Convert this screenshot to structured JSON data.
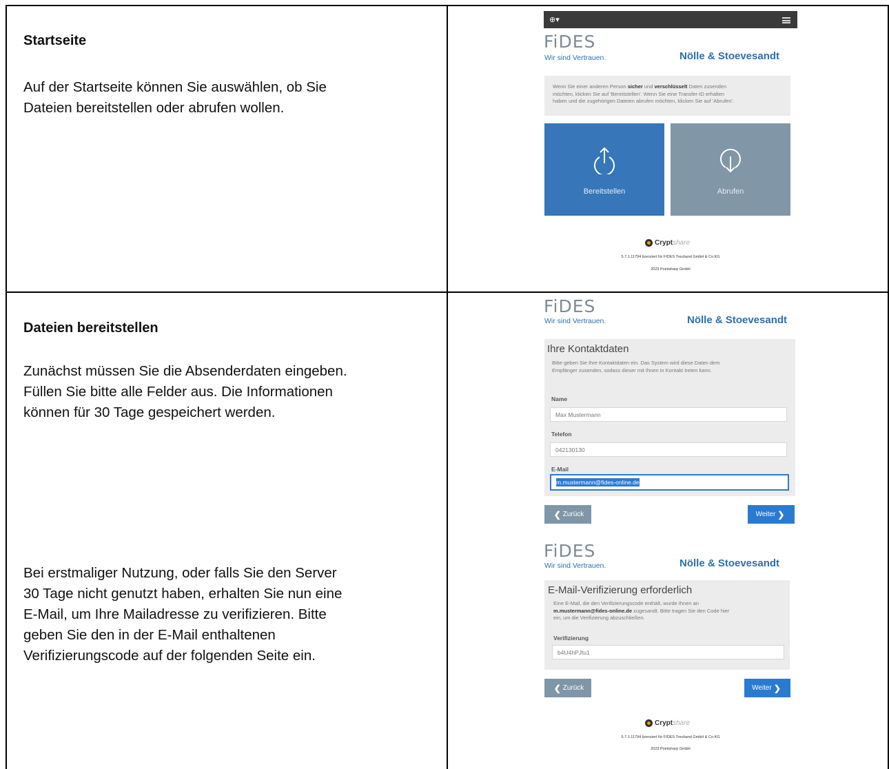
{
  "sections": [
    {
      "heading": "Startseite",
      "paragraphs": [
        "Auf der Startseite können Sie auswählen, ob Sie",
        "Dateien bereitstellen oder abrufen wollen."
      ]
    },
    {
      "heading": "Dateien bereitstellen",
      "paragraphs": [
        "Zunächst müssen Sie die Absenderdaten eingeben.",
        "Füllen Sie bitte alle Felder aus. Die Informationen",
        "können für 30 Tage gespeichert werden."
      ],
      "paragraphs2": [
        "Bei erstmaliger Nutzung, oder falls Sie den Server",
        "30 Tage nicht genutzt haben, erhalten Sie nun eine",
        "E-Mail, um Ihre Mailadresse zu verifizieren. Bitte",
        "geben Sie den in der E-Mail enthaltenen",
        "Verifizierungscode auf der folgenden Seite ein."
      ]
    }
  ],
  "brand": {
    "logo": "FiDES",
    "tagline": "Wir sind Vertrauen.",
    "partner": "Nölle & Stoevesandt",
    "colors": {
      "accent": "#2b7ad1",
      "tile_upload": "#3676b9",
      "tile_download": "#8196a6",
      "logo_gray": "#7e8b95"
    }
  },
  "screen_start": {
    "topbar": {
      "globe_icon": "globe-icon",
      "menu_icon": "hamburger-icon",
      "globe_glyph": "⊕▾"
    },
    "intro": {
      "line1_a": "Wenn Sie einer anderen Person ",
      "line1_b": "sicher",
      "line1_c": " und ",
      "line1_d": "verschlüsselt",
      "line1_e": " Daten zusenden",
      "line2": "möchten, klicken Sie auf 'Bereitstellen'. Wenn Sie eine Transfer-ID erhalten",
      "line3": "haben und die zugehörigen Dateien abrufen möchten, klicken Sie auf 'Abrufen'."
    },
    "tiles": {
      "upload": "Bereitstellen",
      "download": "Abrufen"
    }
  },
  "screen_contact": {
    "title": "Ihre Kontaktdaten",
    "desc1": "Bitte geben Sie Ihre Kontaktdaten ein. Das System wird diese Daten dem",
    "desc2": "Empfänger zusenden, sodass dieser mit Ihnen in Kontakt treten kann.",
    "name_label": "Name",
    "name_value": "Max Mustermann",
    "phone_label": "Telefon",
    "phone_value": "042130130",
    "email_label": "E-Mail",
    "email_value": "m.mustermann@fides-online.de",
    "back": "Zurück",
    "next": "Weiter"
  },
  "screen_verify": {
    "title": "E-Mail-Verifizierung erforderlich",
    "desc1": "Eine E-Mail, die den Verifizierungscode enthält, wurde Ihnen an",
    "desc2_bold": "m.mustermann@fides-online.de",
    "desc2_rest": " zugesandt. Bitte tragen Sie den Code hier",
    "desc3": "ein, um die Verifizierung abzuschließen.",
    "code_label": "Verifizierung",
    "code_value": "b4U4hPJtu1",
    "back": "Zurück",
    "next": "Weiter"
  },
  "footer": {
    "brand_a": "Crypt",
    "brand_b": "share",
    "line1": "5.7.1.11794 lizenziert für FIDES Treuhand GmbH & Co.KG",
    "line2": "2023 Pointsharp GmbH"
  }
}
